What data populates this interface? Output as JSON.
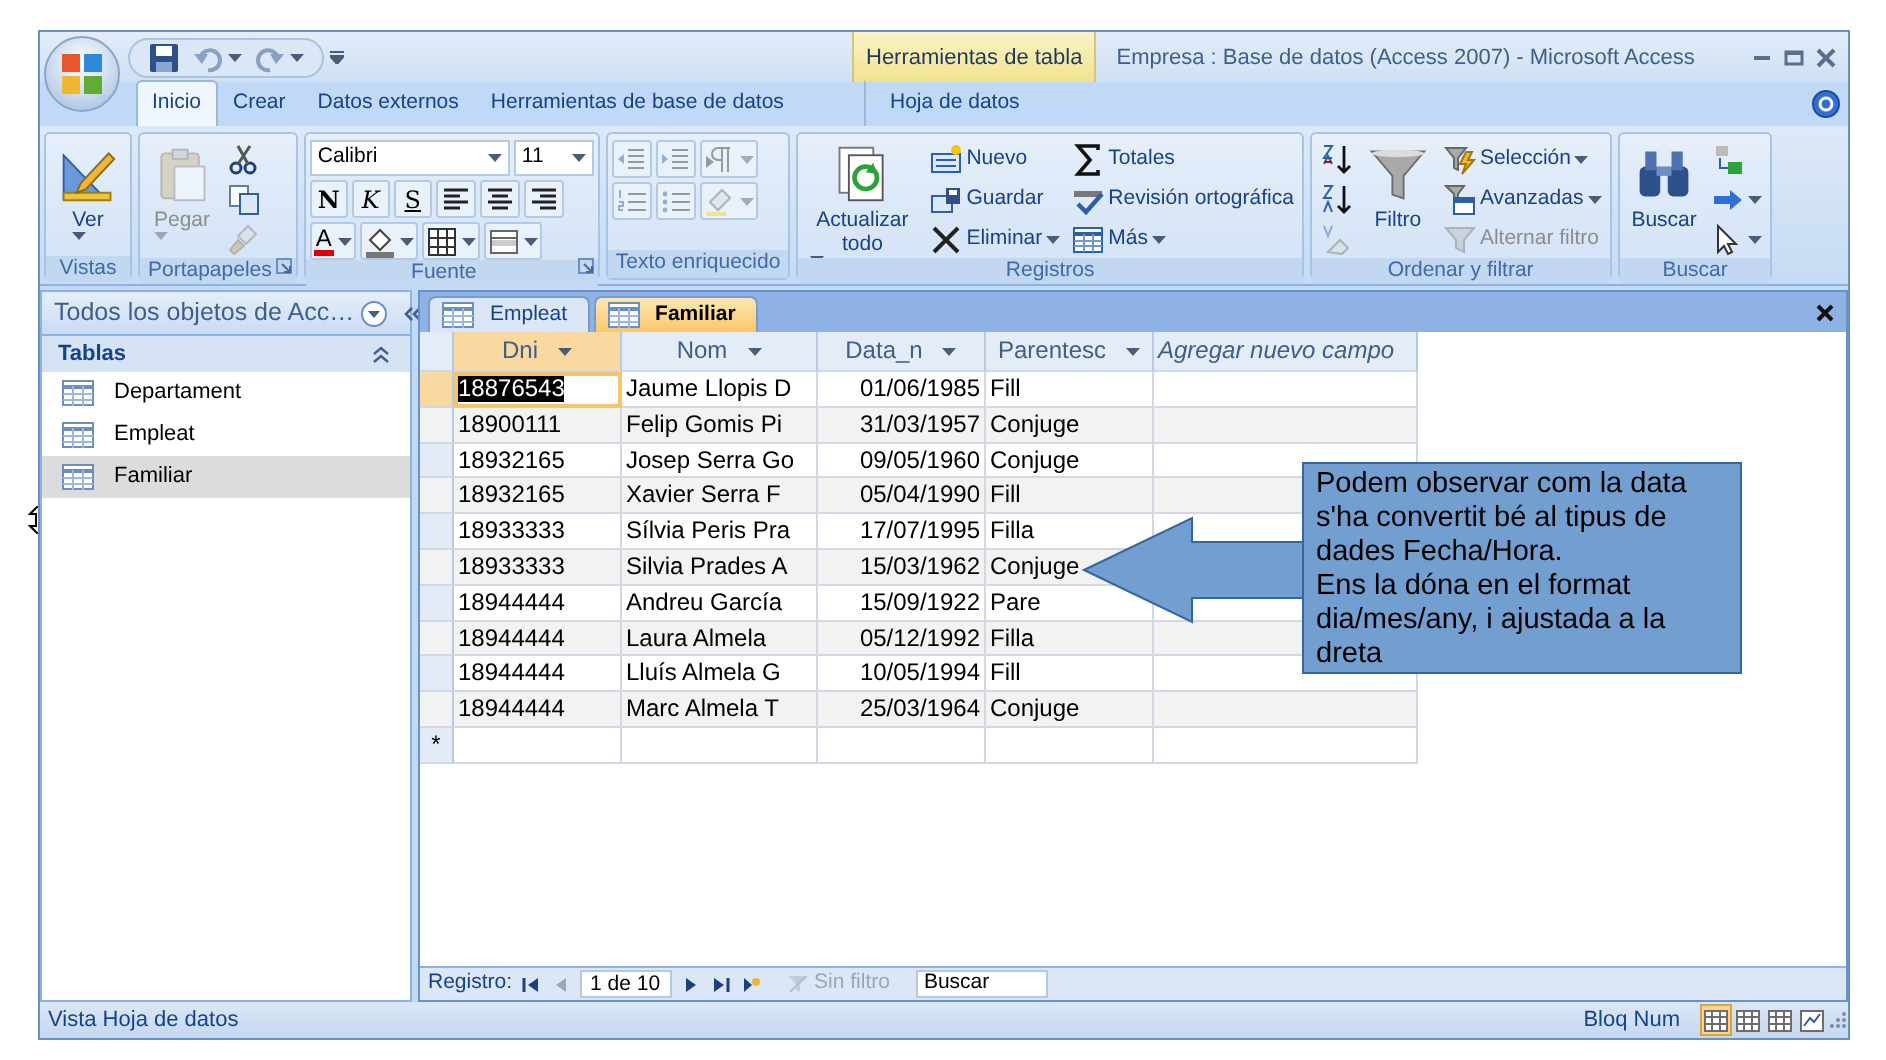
{
  "window": {
    "title": "Empresa : Base de datos (Access 2007) - Microsoft Access",
    "context_label": "Herramientas de tabla"
  },
  "ribbon_tabs": [
    {
      "label": "Inicio",
      "selected": true,
      "contextual": false
    },
    {
      "label": "Crear",
      "selected": false,
      "contextual": false
    },
    {
      "label": "Datos externos",
      "selected": false,
      "contextual": false
    },
    {
      "label": "Herramientas de base de datos",
      "selected": false,
      "contextual": false
    },
    {
      "label": "Hoja de datos",
      "selected": false,
      "contextual": true
    }
  ],
  "ribbon": {
    "groups": [
      {
        "label": "Vistas",
        "launcher": false,
        "kind": "columns",
        "columns": [
          [
            {
              "kind": "large",
              "label": "Ver",
              "dropdown": true,
              "disabled": false
            }
          ]
        ]
      },
      {
        "label": "Portapapeles",
        "launcher": true,
        "kind": "columns",
        "columns": [
          [
            {
              "kind": "large",
              "label": "Pegar",
              "dropdown": true,
              "disabled": true
            }
          ],
          [
            {
              "kind": "icon",
              "dropdown": false,
              "disabled": false
            },
            {
              "kind": "icon",
              "dropdown": false,
              "disabled": false
            },
            {
              "kind": "icon",
              "dropdown": false,
              "disabled": true
            }
          ]
        ]
      },
      {
        "label": "Fuente",
        "launcher": true,
        "kind": "rows",
        "rows": [
          [
            {
              "kind": "combo",
              "value": "Calibri",
              "dropdown": true,
              "disabled": false
            },
            {
              "kind": "combo",
              "value": "11",
              "dropdown": true,
              "disabled": false
            }
          ],
          [
            {
              "kind": "format",
              "label": "N",
              "dropdown": false,
              "disabled": false
            },
            {
              "kind": "format",
              "label": "K",
              "dropdown": false,
              "disabled": false
            },
            {
              "kind": "format",
              "label": "S",
              "dropdown": false,
              "disabled": false
            },
            {
              "kind": "icon",
              "dropdown": false,
              "disabled": false
            },
            {
              "kind": "icon",
              "dropdown": false,
              "disabled": false
            },
            {
              "kind": "icon",
              "dropdown": false,
              "disabled": false
            }
          ],
          [
            {
              "kind": "swatch",
              "label": "A",
              "dropdown": true,
              "disabled": false
            },
            {
              "kind": "icon",
              "dropdown": true,
              "disabled": false
            },
            {
              "kind": "icon",
              "dropdown": true,
              "disabled": false
            },
            {
              "kind": "icon",
              "dropdown": true,
              "disabled": false
            }
          ]
        ]
      },
      {
        "label": "Texto enriquecido",
        "launcher": false,
        "kind": "rows",
        "rows": [
          [
            {
              "kind": "icon",
              "dropdown": false,
              "disabled": true
            },
            {
              "kind": "icon",
              "dropdown": false,
              "disabled": true
            },
            {
              "kind": "icon",
              "dropdown": true,
              "disabled": true
            }
          ],
          [
            {
              "kind": "icon",
              "dropdown": false,
              "disabled": true
            },
            {
              "kind": "icon",
              "dropdown": false,
              "disabled": true
            },
            {
              "kind": "icon",
              "dropdown": true,
              "disabled": true
            }
          ]
        ]
      },
      {
        "label": "Registros",
        "launcher": false,
        "kind": "columns",
        "columns": [
          [
            {
              "kind": "large",
              "label": "Actualizar todo",
              "dropdown": true,
              "disabled": false
            }
          ],
          [
            {
              "kind": "small",
              "label": "Nuevo",
              "dropdown": false,
              "disabled": false
            },
            {
              "kind": "small",
              "label": "Guardar",
              "dropdown": false,
              "disabled": false
            },
            {
              "kind": "small",
              "label": "Eliminar",
              "dropdown": true,
              "disabled": false
            }
          ],
          [
            {
              "kind": "small",
              "label": "Totales",
              "dropdown": false,
              "disabled": false
            },
            {
              "kind": "small",
              "label": "Revisión ortográfica",
              "dropdown": false,
              "disabled": false
            },
            {
              "kind": "small",
              "label": "Más",
              "dropdown": true,
              "disabled": false
            }
          ]
        ]
      },
      {
        "label": "Ordenar y filtrar",
        "launcher": false,
        "kind": "columns",
        "columns": [
          [
            {
              "kind": "icon",
              "dropdown": false,
              "disabled": false
            },
            {
              "kind": "icon",
              "dropdown": false,
              "disabled": false
            },
            {
              "kind": "icon",
              "dropdown": false,
              "disabled": true
            }
          ],
          [
            {
              "kind": "large",
              "label": "Filtro",
              "dropdown": false,
              "disabled": false
            }
          ],
          [
            {
              "kind": "small",
              "label": "Selección",
              "dropdown": true,
              "disabled": false
            },
            {
              "kind": "small",
              "label": "Avanzadas",
              "dropdown": true,
              "disabled": false
            },
            {
              "kind": "small",
              "label": "Alternar filtro",
              "dropdown": false,
              "disabled": true
            }
          ]
        ]
      },
      {
        "label": "Buscar",
        "launcher": false,
        "kind": "columns",
        "columns": [
          [
            {
              "kind": "large",
              "label": "Buscar",
              "dropdown": false,
              "disabled": false
            }
          ],
          [
            {
              "kind": "icon",
              "dropdown": false,
              "disabled": false
            },
            {
              "kind": "icon",
              "dropdown": true,
              "disabled": false
            },
            {
              "kind": "icon",
              "dropdown": true,
              "disabled": false
            }
          ]
        ]
      }
    ]
  },
  "nav_pane": {
    "title": "Todos los objetos de Acc…",
    "section": "Tablas",
    "items": [
      {
        "label": "Departament",
        "selected": false
      },
      {
        "label": "Empleat",
        "selected": false
      },
      {
        "label": "Familiar",
        "selected": true
      }
    ]
  },
  "doc_tabs": [
    {
      "label": "Empleat",
      "selected": false
    },
    {
      "label": "Familiar",
      "selected": true
    }
  ],
  "table": {
    "columns": [
      {
        "label": "Dni",
        "dropdown": true,
        "selected": true
      },
      {
        "label": "Nom",
        "dropdown": true,
        "selected": false
      },
      {
        "label": "Data_n",
        "dropdown": true,
        "selected": false
      },
      {
        "label": "Parentesc",
        "dropdown": true,
        "selected": false
      },
      {
        "label": "Agregar nuevo campo",
        "dropdown": false,
        "selected": false
      }
    ],
    "rows": [
      {
        "selected": true,
        "cells": [
          "18876543",
          "Jaume Llopis D",
          "01/06/1985",
          "Fill"
        ]
      },
      {
        "selected": false,
        "cells": [
          "18900111",
          "Felip Gomis Pi",
          "31/03/1957",
          "Conjuge"
        ]
      },
      {
        "selected": false,
        "cells": [
          "18932165",
          "Josep Serra Go",
          "09/05/1960",
          "Conjuge"
        ]
      },
      {
        "selected": false,
        "cells": [
          "18932165",
          "Xavier Serra F",
          "05/04/1990",
          "Fill"
        ]
      },
      {
        "selected": false,
        "cells": [
          "18933333",
          "Sílvia Peris Pra",
          "17/07/1995",
          "Filla"
        ]
      },
      {
        "selected": false,
        "cells": [
          "18933333",
          "Silvia Prades A",
          "15/03/1962",
          "Conjuge"
        ]
      },
      {
        "selected": false,
        "cells": [
          "18944444",
          "Andreu García",
          "15/09/1922",
          "Pare"
        ]
      },
      {
        "selected": false,
        "cells": [
          "18944444",
          "Laura Almela",
          "05/12/1992",
          "Filla"
        ]
      },
      {
        "selected": false,
        "cells": [
          "18944444",
          "Lluís Almela G",
          "10/05/1994",
          "Fill"
        ]
      },
      {
        "selected": false,
        "cells": [
          "18944444",
          "Marc Almela T",
          "25/03/1964",
          "Conjuge"
        ]
      }
    ],
    "new_row_marker": "*"
  },
  "record_nav": {
    "label": "Registro:",
    "position": "1 de 10",
    "filter": "Sin filtro",
    "filter_active": false,
    "search_placeholder": "Buscar"
  },
  "annotation": {
    "paragraphs": [
      "Podem observar com la data s'ha convertit bé al tipus de dades Fecha/Hora.",
      "Ens la dóna en el format dia/mes/any, i ajustada a la dreta"
    ]
  },
  "status_bar": {
    "text": "Vista Hoja de datos",
    "indicator": "Bloq Num",
    "views": [
      {
        "selected": true
      },
      {
        "selected": false
      },
      {
        "selected": false
      },
      {
        "selected": false
      }
    ]
  }
}
